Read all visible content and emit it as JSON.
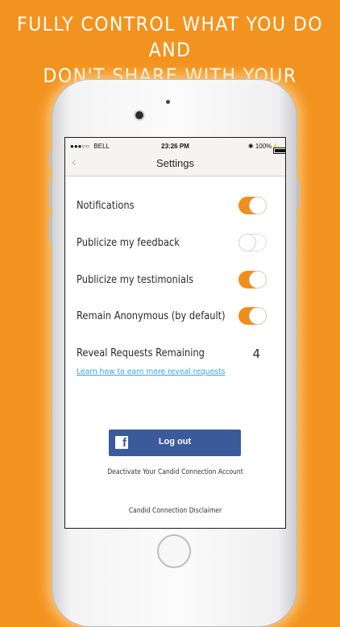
{
  "promo": {
    "line1": "FULLY CONTROL WHAT YOU DO AND",
    "line2": "DON'T SHARE WITH YOUR FRIENDS"
  },
  "status_bar": {
    "signal": "●●●○○",
    "carrier": "BELL",
    "time": "23:26 PM",
    "bluetooth": "✱",
    "battery": "100%"
  },
  "nav": {
    "title": "Settings",
    "back_icon": "‹"
  },
  "settings": {
    "items": [
      {
        "label": "Notifications",
        "on": true
      },
      {
        "label": "Publicize my feedback",
        "on": false
      },
      {
        "label": "Publicize my testimonials",
        "on": true
      },
      {
        "label": "Remain Anonymous (by default)",
        "on": true
      }
    ],
    "reveal": {
      "label": "Reveal Requests Remaining",
      "count": "4"
    },
    "learn_link": "Learn how to earn more reveal requests"
  },
  "actions": {
    "logout_icon": "f",
    "logout_label": "Log out",
    "deactivate_label": "Deactivate Your Candid Connection Account",
    "disclaimer_label": "Candid Connection Disclaimer"
  },
  "colors": {
    "background": "#f3931f",
    "toggle_on": "#ee8f1c",
    "facebook": "#3b5a9a",
    "link": "#3aa3e2"
  }
}
